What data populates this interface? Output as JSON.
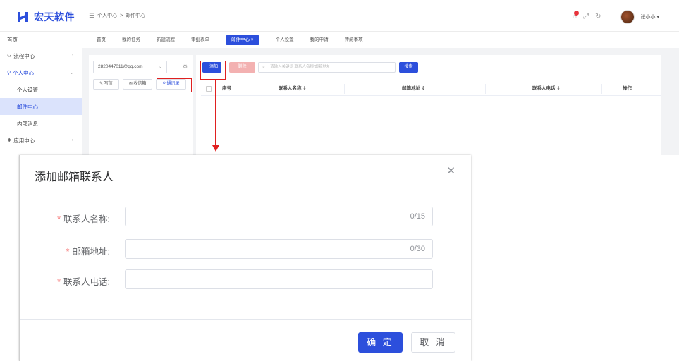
{
  "app": {
    "logo_text": "宏天软件"
  },
  "header": {
    "breadcrumb": [
      "个人中心",
      ">",
      "邮件中心"
    ],
    "user_name": "张小小 ▾"
  },
  "sidebar": {
    "items": [
      {
        "label": "首页"
      },
      {
        "label": "流程中心"
      },
      {
        "label": "个人中心"
      },
      {
        "label": "个人设置"
      },
      {
        "label": "邮件中心"
      },
      {
        "label": "内部消息"
      },
      {
        "label": "应用中心"
      }
    ]
  },
  "tabs": [
    "首页",
    "我的任务",
    "新建流程",
    "审批表单",
    "邮件中心 ×",
    "个人设置",
    "我的申请",
    "传阅事项"
  ],
  "mail": {
    "account": "2820447011@qq.com",
    "folders": [
      "写信",
      "收信箱",
      "通讯录"
    ]
  },
  "toolbar": {
    "add_label": "+ 添加",
    "delete_label": "删除",
    "search_placeholder": "请输入关键词 联系人名称/邮箱地址",
    "search_label": "搜索"
  },
  "table": {
    "columns": [
      "序号",
      "联系人名称 ⇕",
      "邮箱地址 ⇕",
      "联系人电话 ⇕",
      "操作"
    ]
  },
  "dialog": {
    "title": "添加邮箱联系人",
    "fields": [
      {
        "label": "联系人名称:",
        "counter": "0/15"
      },
      {
        "label": "邮箱地址:",
        "counter": "0/30"
      },
      {
        "label": "联系人电话:",
        "counter": ""
      }
    ],
    "ok_label": "确 定",
    "cancel_label": "取 消"
  },
  "colors": {
    "primary": "#2c4fdc",
    "annotation_red": "#e02020",
    "required_star": "#f56c6c"
  }
}
